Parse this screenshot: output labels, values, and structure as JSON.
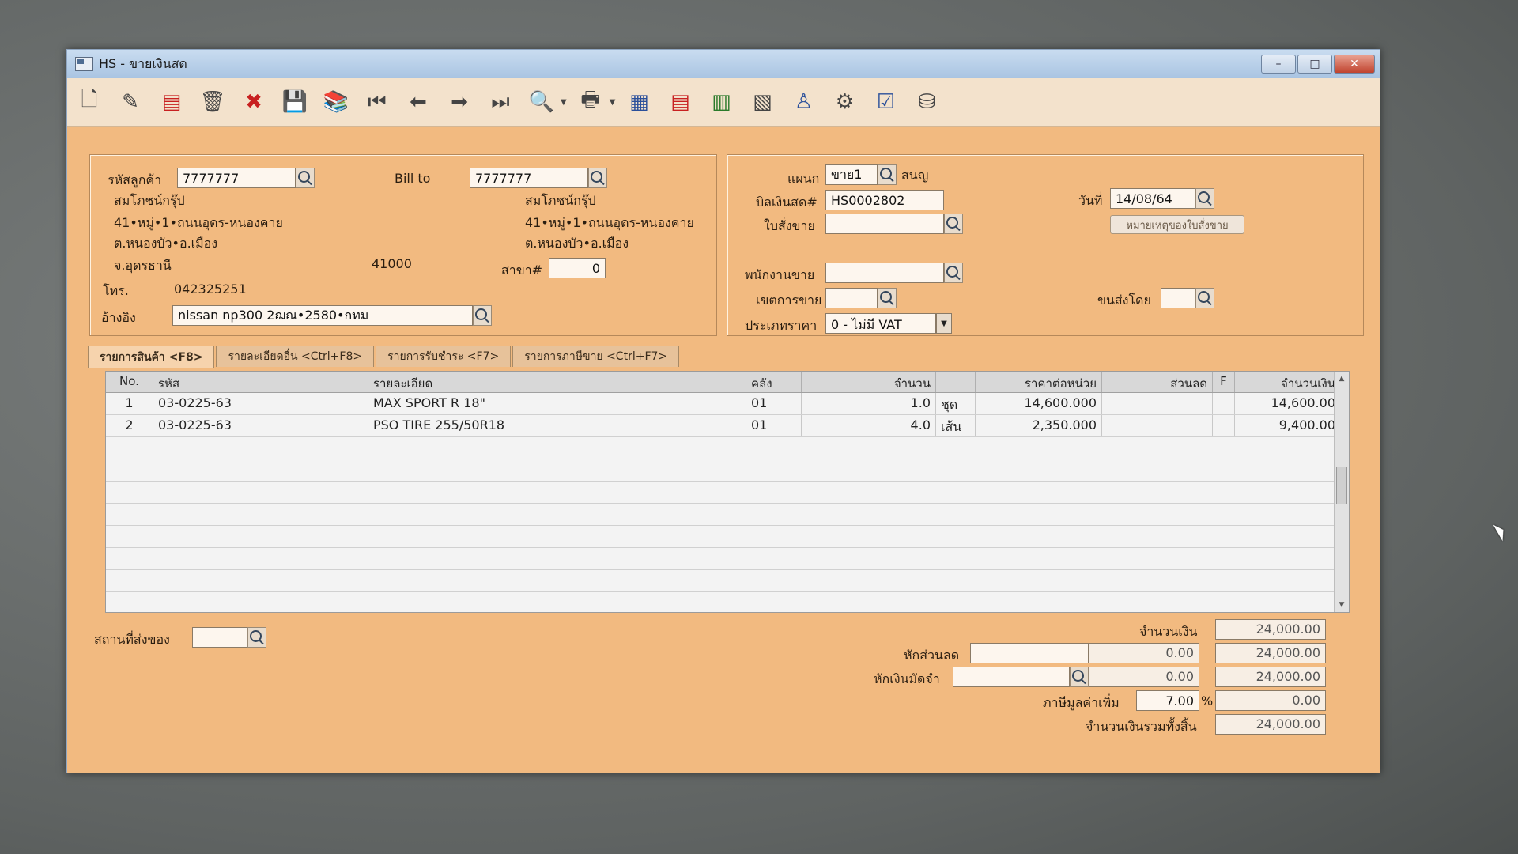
{
  "window": {
    "title": "HS - ขายเงินสด",
    "min_label": "–",
    "max_label": "□",
    "close_label": "✕"
  },
  "toolbar": {
    "icons": [
      "new-doc-icon",
      "edit-icon",
      "stamp-icon",
      "delete-bin-icon",
      "cancel-icon",
      "save-icon",
      "books-icon",
      "first-icon",
      "prev-icon",
      "next-icon",
      "last-icon",
      "preview-icon",
      "print-icon",
      "report1-icon",
      "report2-icon",
      "report3-icon",
      "report4-icon",
      "approve-icon",
      "tools-icon",
      "ok-icon",
      "db-icon"
    ],
    "glyphs": [
      "🗋",
      "✎",
      "▤",
      "🗑",
      "✖",
      "💾",
      "📚",
      "⏮",
      "⬅",
      "➡",
      "⏭",
      "🔍",
      "🖶",
      "▦",
      "▤",
      "▥",
      "▧",
      "♙",
      "⚙",
      "☑",
      "⛁"
    ]
  },
  "customer": {
    "code_label": "รหัสลูกค้า",
    "code_value": "7777777",
    "name": "สมโภชน์กรุ๊ป",
    "addr1": "41•หมู่•1•ถนนอุดร-หนองคาย",
    "addr2": "ต.หนองบัว•อ.เมือง",
    "province": "จ.อุดรธานี",
    "postcode": "41000",
    "phone_label": "โทร.",
    "phone": "042325251",
    "ref_label": "อ้างอิง",
    "ref_value": "nissan np300 2ฌณ•2580•กทม"
  },
  "billto": {
    "label": "Bill to",
    "value": "7777777",
    "name": "สมโภชน์กรุ๊ป",
    "addr1": "41•หมู่•1•ถนนอุดร-หนองคาย",
    "addr2": "ต.หนองบัว•อ.เมือง",
    "branch_label": "สาขา#",
    "branch_value": "0"
  },
  "doc": {
    "dept_label": "แผนก",
    "dept_value": "ขาย1",
    "dept_name": "สนญ",
    "bill_label": "บิลเงินสด#",
    "bill_value": "HS0002802",
    "date_label": "วันที่",
    "date_value": "14/08/64",
    "so_label": "ใบสั่งขาย",
    "so_value": "",
    "so_note_button": "หมายเหตุของใบสั่งขาย",
    "sales_label": "พนักงานขาย",
    "area_label": "เขตการขาย",
    "ship_label": "ขนส่งโดย",
    "price_type_label": "ประเภทราคา",
    "price_type_value": "0 - ไม่มี VAT"
  },
  "tabs": [
    {
      "label": "รายการสินค้า <F8>"
    },
    {
      "label": "รายละเอียดอื่น <Ctrl+F8>"
    },
    {
      "label": "รายการรับชำระ <F7>"
    },
    {
      "label": "รายการภาษีขาย <Ctrl+F7>"
    }
  ],
  "table": {
    "headers": [
      "No.",
      "รหัส",
      "รายละเอียด",
      "คลัง",
      "",
      "จำนวน",
      "",
      "ราคาต่อหน่วย",
      "ส่วนลด",
      "F",
      "จำนวนเงิน"
    ],
    "rows": [
      [
        "1",
        "03-0225-63",
        "MAX SPORT R 18\"",
        "01",
        "",
        "1.0",
        "ชุด",
        "14,600.000",
        "",
        "",
        "14,600.00"
      ],
      [
        "2",
        "03-0225-63",
        "PSO TIRE 255/50R18",
        "01",
        "",
        "4.0",
        "เส้น",
        "2,350.000",
        "",
        "",
        "9,400.00"
      ]
    ]
  },
  "footer": {
    "ship_place_label": "สถานที่ส่งของ",
    "amount_label": "จำนวนเงิน",
    "amount_value": "24,000.00",
    "discount_label": "หักส่วนลด",
    "discount_value": "0.00",
    "after_discount": "24,000.00",
    "deposit_label": "หักเงินมัดจำ",
    "deposit_value": "0.00",
    "after_deposit": "24,000.00",
    "vat_label": "ภาษีมูลค่าเพิ่ม",
    "vat_rate": "7.00",
    "vat_pct": "%",
    "vat_value": "0.00",
    "total_label": "จำนวนเงินรวมทั้งสิ้น",
    "total_value": "24,000.00"
  }
}
